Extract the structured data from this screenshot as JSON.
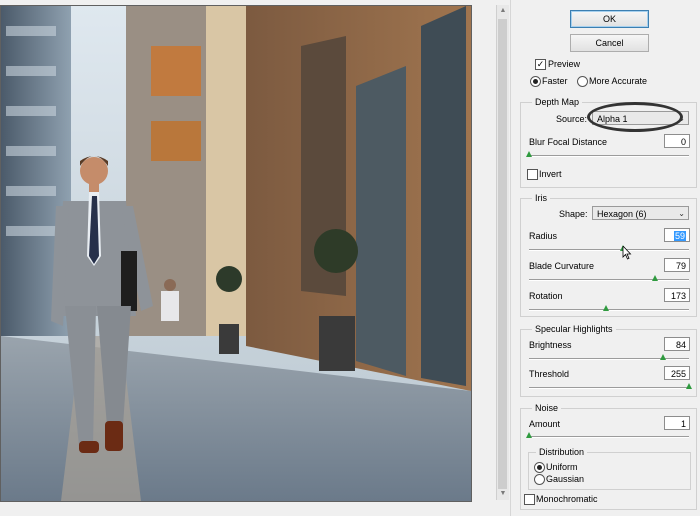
{
  "buttons": {
    "ok": "OK",
    "cancel": "Cancel"
  },
  "preview": {
    "label": "Preview",
    "checked": true
  },
  "quality": {
    "faster": "Faster",
    "more_accurate": "More Accurate",
    "selected": "Faster"
  },
  "depth_map": {
    "title": "Depth Map",
    "source_label": "Source:",
    "source_value": "Alpha 1",
    "blur_focal_label": "Blur Focal Distance",
    "blur_focal_value": "0",
    "invert_label": "Invert"
  },
  "iris": {
    "title": "Iris",
    "shape_label": "Shape:",
    "shape_value": "Hexagon (6)",
    "radius_label": "Radius",
    "radius_value": "59",
    "blade_label": "Blade Curvature",
    "blade_value": "79",
    "rotation_label": "Rotation",
    "rotation_value": "173"
  },
  "specular": {
    "title": "Specular Highlights",
    "brightness_label": "Brightness",
    "brightness_value": "84",
    "threshold_label": "Threshold",
    "threshold_value": "255"
  },
  "noise": {
    "title": "Noise",
    "amount_label": "Amount",
    "amount_value": "1",
    "distribution_title": "Distribution",
    "uniform": "Uniform",
    "gaussian": "Gaussian",
    "selected": "Uniform",
    "monochromatic_label": "Monochromatic"
  },
  "slider_fractions": {
    "blur_focal": 0.0,
    "radius": 0.59,
    "blade": 0.79,
    "rotation": 0.48,
    "brightness": 0.84,
    "threshold": 1.0,
    "amount": 0.0
  },
  "colors": {
    "slider_knob": "#2f9a3f",
    "selection": "#3399ff",
    "ok_border": "#3c7fb1"
  }
}
